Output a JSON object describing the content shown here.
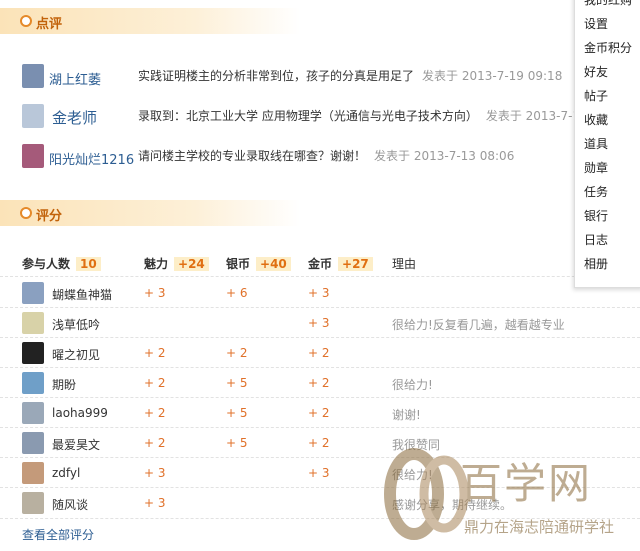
{
  "comments_section": {
    "title": "点评"
  },
  "comments": [
    {
      "name": "湖上红萎",
      "text": "实践证明楼主的分析非常到位，孩子的分真是用足了",
      "time": "发表于 2013-7-19 09:18",
      "avatar_color": "#7a8fb0"
    },
    {
      "name": "金老师",
      "text": "录取到：北京工业大学 应用物理学（光通信与光电子技术方向）",
      "time": "发表于 2013-7-17",
      "avatar_color": "#b9c7d9"
    },
    {
      "name": "阳光灿烂1216",
      "text": "请问楼主学校的专业录取线在哪查？谢谢！",
      "time": "发表于 2013-7-13 08:06",
      "avatar_color": "#a55a7a"
    }
  ],
  "rating_section": {
    "title": "评分"
  },
  "rating_header": {
    "participants_label": "参与人数",
    "participants_count": "10",
    "charm_label": "魅力",
    "charm_total": "+24",
    "silver_label": "银币",
    "silver_total": "+40",
    "gold_label": "金币",
    "gold_total": "+27",
    "reason_label": "理由"
  },
  "ratings": [
    {
      "user": "蝴蝶鱼神猫",
      "charm": "+ 3",
      "silver": "+ 6",
      "gold": "+ 3",
      "reason": "",
      "avatar_color": "#8aa0c0"
    },
    {
      "user": "浅草低吟",
      "charm": "",
      "silver": "",
      "gold": "+ 3",
      "reason": "很给力!反复看几遍，越看越专业",
      "avatar_color": "#d8d2a8"
    },
    {
      "user": "曜之初见",
      "charm": "+ 2",
      "silver": "+ 2",
      "gold": "+ 2",
      "reason": "",
      "avatar_color": "#222222"
    },
    {
      "user": "期盼",
      "charm": "+ 2",
      "silver": "+ 5",
      "gold": "+ 2",
      "reason": "很给力!",
      "avatar_color": "#6f9fc8"
    },
    {
      "user": "laoha999",
      "charm": "+ 2",
      "silver": "+ 5",
      "gold": "+ 2",
      "reason": "谢谢!",
      "avatar_color": "#9aa8b8"
    },
    {
      "user": "最爱昊文",
      "charm": "+ 2",
      "silver": "+ 5",
      "gold": "+ 2",
      "reason": "我很赞同",
      "avatar_color": "#8a9ab0"
    },
    {
      "user": "zdfyl",
      "charm": "+ 3",
      "silver": "",
      "gold": "+ 3",
      "reason": "很给力!",
      "avatar_color": "#c49a7a"
    },
    {
      "user": "随风谈",
      "charm": "+ 3",
      "silver": "",
      "gold": "",
      "reason": "感谢分享，期待继续。",
      "avatar_color": "#b8b0a0"
    }
  ],
  "view_all_label": "查看全部评分",
  "dropdown_menu": [
    "我的红购",
    "设置",
    "金币积分",
    "好友",
    "帖子",
    "收藏",
    "道具",
    "勋章",
    "任务",
    "银行",
    "日志",
    "相册"
  ],
  "watermark": {
    "brand": "百学网",
    "sub": "鼎力在海志陪通研学社"
  },
  "colors": {
    "accent": "#e06f12",
    "link": "#2c5d92",
    "plus": "#e0712a"
  }
}
